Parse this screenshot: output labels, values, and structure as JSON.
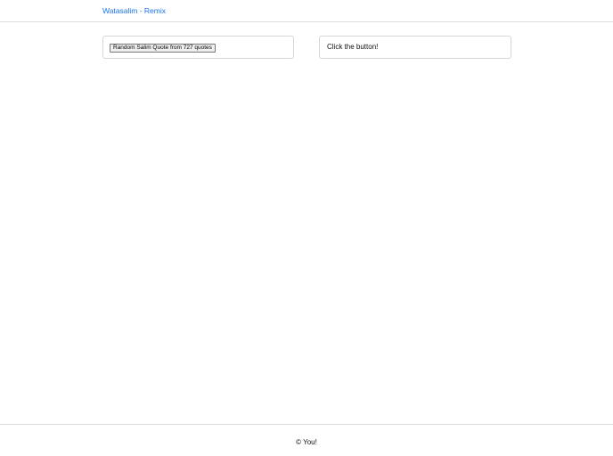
{
  "header": {
    "brand": "Watasalim - Remix"
  },
  "main": {
    "quote_button_label": "Random Salim Quote from 727 quotes",
    "quote_display": "Click the button!"
  },
  "footer": {
    "text": "© You!"
  },
  "colors": {
    "link": "#1a73e8",
    "border": "#dcdcdc"
  }
}
